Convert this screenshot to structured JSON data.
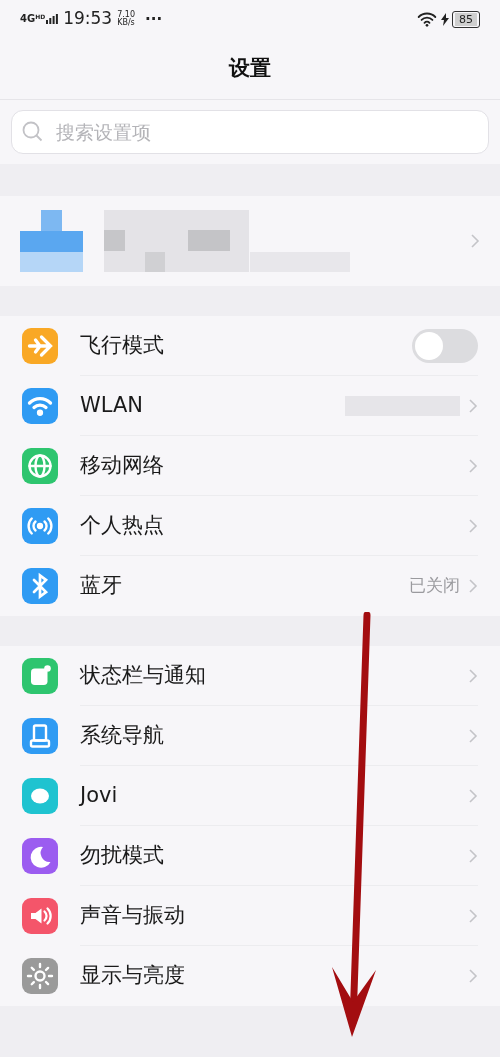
{
  "status_bar": {
    "network": "4G",
    "network_badge": "HD",
    "time": "19:53",
    "speed_value": "7.10",
    "speed_unit": "KB/s",
    "more": "···",
    "battery": "85",
    "charging": true
  },
  "title": "设置",
  "search": {
    "placeholder": "搜索设置项"
  },
  "account": {
    "kind": "picture"
  },
  "groups": [
    [
      {
        "label": "飞行模式",
        "kind": "toggle",
        "on": false,
        "color": "#f9a825"
      },
      {
        "label": "WLAN",
        "kind": "link",
        "hidden_value": true,
        "color": "#2f9bf3"
      },
      {
        "label": "移动网络",
        "kind": "link",
        "color": "#2ec56f"
      },
      {
        "label": "个人热点",
        "kind": "link",
        "color": "#2f9bf3"
      },
      {
        "label": "蓝牙",
        "kind": "link",
        "value": "已关闭",
        "color": "#2f9bf3"
      }
    ],
    [
      {
        "label": "状态栏与通知",
        "kind": "link",
        "color": "#2ec56f"
      },
      {
        "label": "系统导航",
        "kind": "link",
        "color": "#2f9bf3"
      },
      {
        "label": "Jovi",
        "kind": "link",
        "color": "#1fc3d0"
      },
      {
        "label": "勿扰模式",
        "kind": "link",
        "color": "#9b5cf0"
      },
      {
        "label": "声音与振动",
        "kind": "link",
        "color": "#f4556a"
      },
      {
        "label": "显示与亮度",
        "kind": "link",
        "color": "#9a9a9a"
      }
    ]
  ]
}
